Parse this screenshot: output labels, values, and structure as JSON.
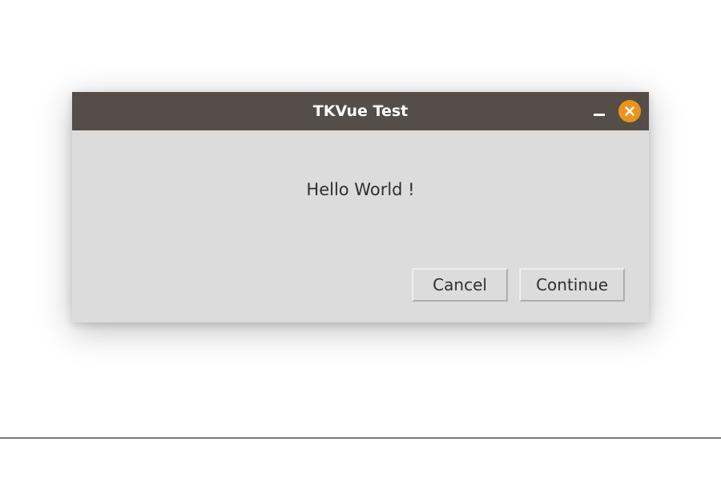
{
  "window": {
    "title": "TKVue Test"
  },
  "body": {
    "message": "Hello World !"
  },
  "buttons": {
    "cancel": "Cancel",
    "continue": "Continue"
  }
}
